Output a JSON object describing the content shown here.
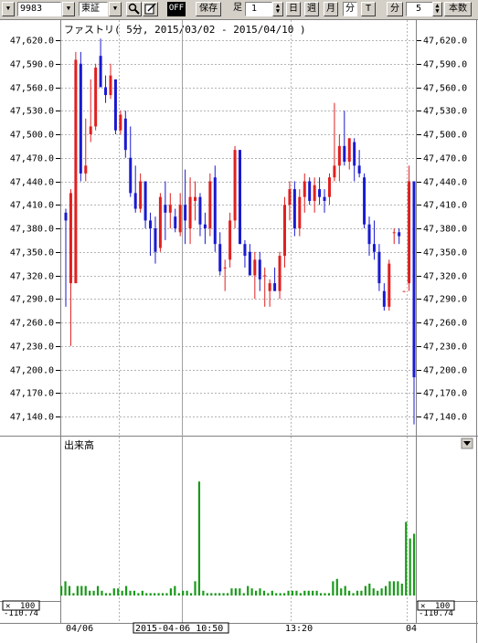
{
  "toolbar": {
    "code": "9983",
    "market": "東証",
    "off_label": "OFF",
    "save_label": "保存",
    "bar_label": "足",
    "bar_count": "1",
    "periods": [
      "日",
      "週",
      "月",
      "分",
      "T"
    ],
    "active_period": "分",
    "minute_label": "分",
    "minute_value": "5",
    "count_label": "本数"
  },
  "colors": {
    "up": "#e02020",
    "down": "#1a1ad0",
    "volume": "#1a9a1a",
    "grid": "#b4b4b4"
  },
  "chart_data": [
    {
      "type": "candlestick",
      "title": "ファストリ( 5分, 2015/03/02 - 2015/04/10 )",
      "y_ticks": [
        "47,620.0",
        "47,590.0",
        "47,560.0",
        "47,530.0",
        "47,500.0",
        "47,470.0",
        "47,440.0",
        "47,410.0",
        "47,380.0",
        "47,350.0",
        "47,320.0",
        "47,290.0",
        "47,260.0",
        "47,230.0",
        "47,200.0",
        "47,170.0",
        "47,140.0"
      ],
      "ylim": [
        47140,
        47620
      ],
      "candles": [
        {
          "o": 47400,
          "h": 47405,
          "l": 47280,
          "c": 47390
        },
        {
          "o": 47310,
          "h": 47430,
          "l": 47230,
          "c": 47425
        },
        {
          "o": 47310,
          "h": 47605,
          "l": 47310,
          "c": 47595
        },
        {
          "o": 47590,
          "h": 47605,
          "l": 47440,
          "c": 47450
        },
        {
          "o": 47450,
          "h": 47520,
          "l": 47440,
          "c": 47460
        },
        {
          "o": 47500,
          "h": 47570,
          "l": 47490,
          "c": 47510
        },
        {
          "o": 47510,
          "h": 47590,
          "l": 47505,
          "c": 47585
        },
        {
          "o": 47600,
          "h": 47622,
          "l": 47560,
          "c": 47560
        },
        {
          "o": 47560,
          "h": 47575,
          "l": 47540,
          "c": 47550
        },
        {
          "o": 47550,
          "h": 47590,
          "l": 47545,
          "c": 47575
        },
        {
          "o": 47570,
          "h": 47570,
          "l": 47500,
          "c": 47505
        },
        {
          "o": 47505,
          "h": 47530,
          "l": 47500,
          "c": 47525
        },
        {
          "o": 47520,
          "h": 47530,
          "l": 47470,
          "c": 47480
        },
        {
          "o": 47470,
          "h": 47510,
          "l": 47420,
          "c": 47425
        },
        {
          "o": 47425,
          "h": 47460,
          "l": 47400,
          "c": 47405
        },
        {
          "o": 47405,
          "h": 47450,
          "l": 47400,
          "c": 47440
        },
        {
          "o": 47440,
          "h": 47440,
          "l": 47380,
          "c": 47390
        },
        {
          "o": 47390,
          "h": 47400,
          "l": 47345,
          "c": 47380
        },
        {
          "o": 47380,
          "h": 47395,
          "l": 47335,
          "c": 47350
        },
        {
          "o": 47355,
          "h": 47425,
          "l": 47350,
          "c": 47420
        },
        {
          "o": 47410,
          "h": 47440,
          "l": 47365,
          "c": 47400
        },
        {
          "o": 47400,
          "h": 47425,
          "l": 47380,
          "c": 47410
        },
        {
          "o": 47395,
          "h": 47405,
          "l": 47375,
          "c": 47380
        },
        {
          "o": 47375,
          "h": 47425,
          "l": 47370,
          "c": 47410
        },
        {
          "o": 47410,
          "h": 47455,
          "l": 47360,
          "c": 47390
        },
        {
          "o": 47380,
          "h": 47445,
          "l": 47360,
          "c": 47420
        },
        {
          "o": 47415,
          "h": 47440,
          "l": 47390,
          "c": 47420
        },
        {
          "o": 47420,
          "h": 47425,
          "l": 47370,
          "c": 47385
        },
        {
          "o": 47385,
          "h": 47400,
          "l": 47360,
          "c": 47380
        },
        {
          "o": 47380,
          "h": 47450,
          "l": 47370,
          "c": 47440
        },
        {
          "o": 47445,
          "h": 47460,
          "l": 47350,
          "c": 47360
        },
        {
          "o": 47360,
          "h": 47375,
          "l": 47320,
          "c": 47325
        },
        {
          "o": 47330,
          "h": 47340,
          "l": 47300,
          "c": 47330
        },
        {
          "o": 47340,
          "h": 47400,
          "l": 47330,
          "c": 47390
        },
        {
          "o": 47390,
          "h": 47485,
          "l": 47380,
          "c": 47480
        },
        {
          "o": 47480,
          "h": 47480,
          "l": 47360,
          "c": 47360
        },
        {
          "o": 47360,
          "h": 47365,
          "l": 47330,
          "c": 47345
        },
        {
          "o": 47350,
          "h": 47360,
          "l": 47320,
          "c": 47320
        },
        {
          "o": 47320,
          "h": 47350,
          "l": 47290,
          "c": 47340
        },
        {
          "o": 47340,
          "h": 47350,
          "l": 47300,
          "c": 47315
        },
        {
          "o": 47320,
          "h": 47330,
          "l": 47280,
          "c": 47320
        },
        {
          "o": 47300,
          "h": 47315,
          "l": 47280,
          "c": 47310
        },
        {
          "o": 47310,
          "h": 47330,
          "l": 47300,
          "c": 47300
        },
        {
          "o": 47300,
          "h": 47350,
          "l": 47290,
          "c": 47345
        },
        {
          "o": 47345,
          "h": 47420,
          "l": 47330,
          "c": 47410
        },
        {
          "o": 47410,
          "h": 47440,
          "l": 47390,
          "c": 47430
        },
        {
          "o": 47430,
          "h": 47440,
          "l": 47370,
          "c": 47380
        },
        {
          "o": 47380,
          "h": 47430,
          "l": 47370,
          "c": 47420
        },
        {
          "o": 47420,
          "h": 47450,
          "l": 47400,
          "c": 47440
        },
        {
          "o": 47440,
          "h": 47445,
          "l": 47410,
          "c": 47415
        },
        {
          "o": 47415,
          "h": 47445,
          "l": 47400,
          "c": 47435
        },
        {
          "o": 47430,
          "h": 47445,
          "l": 47410,
          "c": 47420
        },
        {
          "o": 47420,
          "h": 47430,
          "l": 47400,
          "c": 47415
        },
        {
          "o": 47420,
          "h": 47450,
          "l": 47410,
          "c": 47445
        },
        {
          "o": 47445,
          "h": 47540,
          "l": 47440,
          "c": 47460
        },
        {
          "o": 47460,
          "h": 47500,
          "l": 47440,
          "c": 47485
        },
        {
          "o": 47485,
          "h": 47530,
          "l": 47460,
          "c": 47465
        },
        {
          "o": 47465,
          "h": 47495,
          "l": 47455,
          "c": 47495
        },
        {
          "o": 47490,
          "h": 47495,
          "l": 47440,
          "c": 47460
        },
        {
          "o": 47460,
          "h": 47480,
          "l": 47445,
          "c": 47450
        },
        {
          "o": 47445,
          "h": 47450,
          "l": 47380,
          "c": 47385
        },
        {
          "o": 47385,
          "h": 47395,
          "l": 47345,
          "c": 47360
        },
        {
          "o": 47360,
          "h": 47390,
          "l": 47340,
          "c": 47350
        },
        {
          "o": 47350,
          "h": 47360,
          "l": 47300,
          "c": 47310
        },
        {
          "o": 47300,
          "h": 47310,
          "l": 47275,
          "c": 47280
        },
        {
          "o": 47280,
          "h": 47340,
          "l": 47275,
          "c": 47335
        },
        {
          "o": 47375,
          "h": 47380,
          "l": 47360,
          "c": 47375
        },
        {
          "o": 47375,
          "h": 47380,
          "l": 47360,
          "c": 47370
        },
        {
          "o": 47300,
          "h": 47300,
          "l": 47300,
          "c": 47300
        },
        {
          "o": 47310,
          "h": 47460,
          "l": 47300,
          "c": 47440
        },
        {
          "o": 47440,
          "h": 47440,
          "l": 47130,
          "c": 47190
        }
      ],
      "volume": {
        "label": "出来高",
        "scale_label": "100",
        "scale_value": "-110.74",
        "values": [
          0.4,
          0.6,
          0.4,
          0.1,
          0.4,
          0.4,
          0.4,
          0.2,
          0.2,
          0.4,
          0.2,
          0.1,
          0.1,
          0.3,
          0.3,
          0.2,
          0.4,
          0.2,
          0.2,
          0.1,
          0.2,
          0.1,
          0.1,
          0.1,
          0.1,
          0.1,
          0.1,
          0.3,
          0.4,
          0.1,
          0.2,
          0.2,
          0.1,
          0.6,
          4.8,
          0.2,
          0.1,
          0.1,
          0.1,
          0.1,
          0.1,
          0.1,
          0.3,
          0.3,
          0.3,
          0.1,
          0.4,
          0.3,
          0.2,
          0.3,
          0.2,
          0.1,
          0.2,
          0.1,
          0.1,
          0.1,
          0.2,
          0.2,
          0.2,
          0.1,
          0.2,
          0.2,
          0.2,
          0.2,
          0.1,
          0.1,
          0.1,
          0.6,
          0.7,
          0.3,
          0.4,
          0.2,
          0.1,
          0.2,
          0.2,
          0.4,
          0.5,
          0.3,
          0.2,
          0.3,
          0.4,
          0.6,
          0.6,
          0.6,
          0.5,
          3.1,
          2.4,
          2.6
        ]
      },
      "x_ticks": {
        "first": "04/06",
        "cursor": "2015-04-06  10:50",
        "mid": "13:20",
        "last": "04"
      }
    }
  ]
}
